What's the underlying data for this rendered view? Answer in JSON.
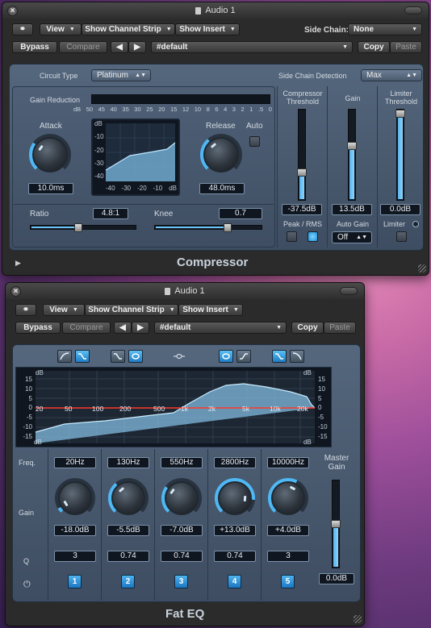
{
  "compressor": {
    "title": "Audio 1",
    "toolbar": {
      "view": "View",
      "show_channel_strip": "Show Channel Strip",
      "show_insert": "Show Insert",
      "side_chain_label": "Side Chain:",
      "side_chain_value": "None",
      "bypass": "Bypass",
      "compare": "Compare",
      "preset": "#default",
      "copy": "Copy",
      "paste": "Paste"
    },
    "circuit_type_label": "Circuit Type",
    "circuit_type_value": "Platinum",
    "side_chain_detection_label": "Side Chain Detection",
    "side_chain_detection_value": "Max",
    "gain_reduction_label": "Gain Reduction",
    "gr_scale": [
      "dB",
      "50",
      "45",
      "40",
      "35",
      "30",
      "25",
      "20",
      "15",
      "12",
      "10",
      "8",
      "6",
      "4",
      "3",
      "2",
      "1",
      ".5",
      "0"
    ],
    "attack_label": "Attack",
    "attack_value": "10.0ms",
    "attack_level": 0.3,
    "release_label": "Release",
    "release_value": "48.0ms",
    "release_level": 0.35,
    "auto_label": "Auto",
    "graph_y_labels": [
      "dB",
      "-10",
      "-20",
      "-30",
      "-40"
    ],
    "graph_x_labels": [
      "-40",
      "-30",
      "-20",
      "-10",
      "dB"
    ],
    "ratio_label": "Ratio",
    "ratio_value": "4.8:1",
    "ratio_level": 0.45,
    "knee_label": "Knee",
    "knee_value": "0.7",
    "knee_level": 0.68,
    "compressor_threshold_label": "Compressor Threshold",
    "compressor_threshold_value": "-37.5dB",
    "compressor_threshold_level": 0.3,
    "gain_label": "Gain",
    "gain_value": "13.5dB",
    "gain_level": 0.6,
    "limiter_threshold_label": "Limiter Threshold",
    "limiter_threshold_value": "0.0dB",
    "limiter_threshold_level": 0.98,
    "peak_rms_label": "Peak / RMS",
    "auto_gain_label": "Auto Gain",
    "auto_gain_value": "Off",
    "limiter_label": "Limiter",
    "plugin_name": "Compressor"
  },
  "eq": {
    "title": "Audio 1",
    "toolbar": {
      "view": "View",
      "show_channel_strip": "Show Channel Strip",
      "show_insert": "Show Insert",
      "bypass": "Bypass",
      "compare": "Compare",
      "preset": "#default",
      "copy": "Copy",
      "paste": "Paste"
    },
    "graph_y_left": [
      "15",
      "10",
      "5",
      "0",
      "-5",
      "-10",
      "-15"
    ],
    "graph_y_right": [
      "15",
      "10",
      "5",
      "0",
      "-5",
      "-10",
      "-15"
    ],
    "graph_x_labels": [
      "20",
      "50",
      "100",
      "200",
      "500",
      "1k",
      "2k",
      "5k",
      "10k",
      "20k"
    ],
    "db_top_left": "dB",
    "db_top_right": "dB",
    "db_bottom_left": "dB",
    "db_bottom_right": "dB",
    "freq_label": "Freq.",
    "gain_label": "Gain",
    "q_label": "Q",
    "power_label": "⏻",
    "bands": [
      {
        "freq": "20Hz",
        "gain": "-18.0dB",
        "q": "3",
        "num": "1",
        "level": 0.05
      },
      {
        "freq": "130Hz",
        "gain": "-5.5dB",
        "q": "0.74",
        "num": "2",
        "level": 0.35
      },
      {
        "freq": "550Hz",
        "gain": "-7.0dB",
        "q": "0.74",
        "num": "3",
        "level": 0.3
      },
      {
        "freq": "2800Hz",
        "gain": "+13.0dB",
        "q": "0.74",
        "num": "4",
        "level": 0.85
      },
      {
        "freq": "10000Hz",
        "gain": "+4.0dB",
        "q": "3",
        "num": "5",
        "level": 0.6
      }
    ],
    "master_gain_label": "Master Gain",
    "master_gain_value": "0.0dB",
    "master_gain_level": 0.5,
    "plugin_name": "Fat EQ"
  }
}
